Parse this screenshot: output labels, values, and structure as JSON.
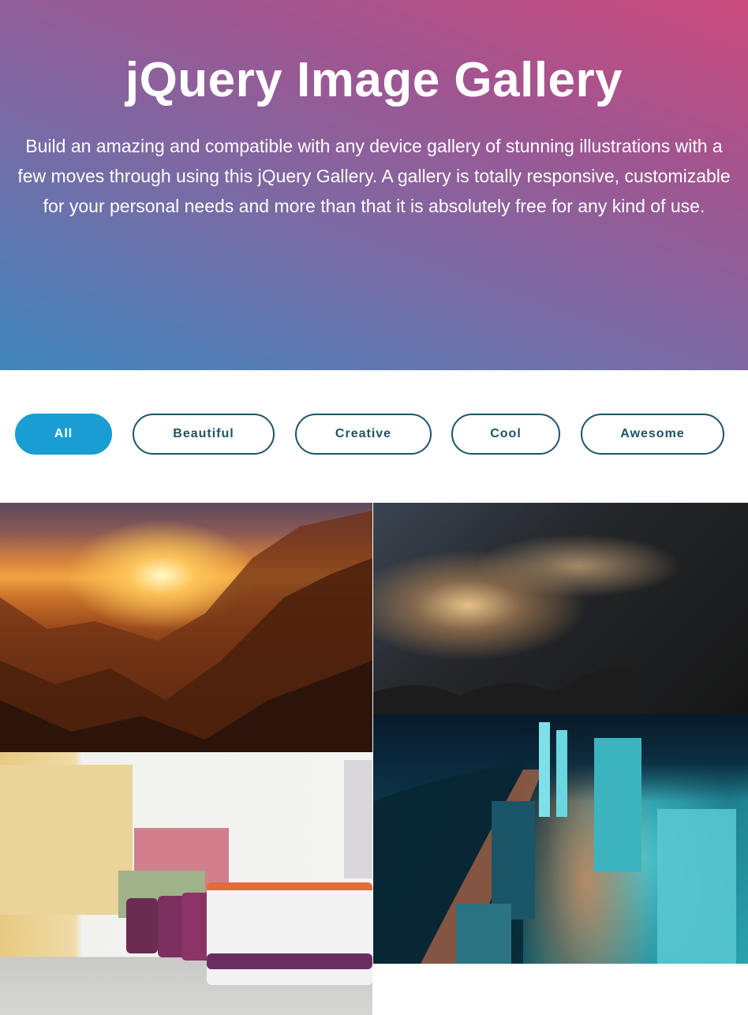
{
  "hero": {
    "title": "jQuery Image Gallery",
    "description": "Build an amazing and compatible with any device gallery of stunning illustrations with a few moves through using this jQuery Gallery. A gallery is totally responsive, customizable for your personal needs and more than that it is absolutely free for any kind of use.",
    "gradient_colors": [
      "#cc4a7c",
      "#7a6aa5",
      "#3f86bd"
    ]
  },
  "filters": [
    {
      "label": "All",
      "active": true
    },
    {
      "label": "Beautiful",
      "active": false
    },
    {
      "label": "Creative",
      "active": false
    },
    {
      "label": "Cool",
      "active": false
    },
    {
      "label": "Awesome",
      "active": false
    }
  ],
  "colors": {
    "active_filter": "#1a9dd2",
    "filter_border": "#1f5368"
  },
  "gallery": [
    {
      "name": "sunset-mountains-image"
    },
    {
      "name": "dark-clouds-image"
    },
    {
      "name": "city-night-aerial-image"
    },
    {
      "name": "buses-parking-image"
    }
  ]
}
